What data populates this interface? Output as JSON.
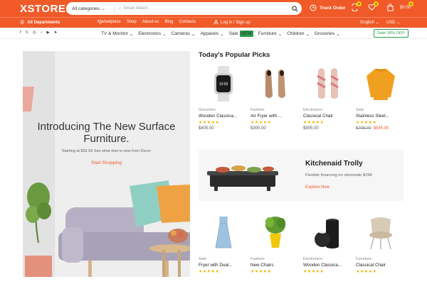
{
  "header": {
    "logo": "XSTORE.",
    "search": {
      "category": "All categories",
      "placeholder": "Smart Watch"
    },
    "track_order": "Track Order",
    "wishlist_count": "0",
    "compare_count": "0",
    "cart_count": "0",
    "cart_total": "$0.00"
  },
  "nav": {
    "all_departments": "All Departments",
    "links": [
      "Marketplace",
      "Shop",
      "About us",
      "Blog",
      "Contacts"
    ],
    "login": "Log in / Sign up",
    "language": "English",
    "currency": "USD"
  },
  "categories": {
    "items": [
      "TV & Monitor",
      "Electronics",
      "Cameras",
      "Apparels",
      "Sale",
      "Furniture",
      "Children",
      "Groceries"
    ],
    "new_tag": "NEW",
    "sale_button": "Sale! 30% OFF!"
  },
  "hero": {
    "title": "Introducing The New Surface Furniture.",
    "subtitle": "Starting at $59.99 See what else is new from Decor",
    "cta": "Start Shopping"
  },
  "popular": {
    "title": "Today's Popular Picks",
    "row1": [
      {
        "category": "Groceries",
        "name": "Wooden Classica...",
        "stars": "★★★★★",
        "price": "$405.00",
        "icon": "smartwatch-icon"
      },
      {
        "category": "Fashion",
        "name": "Air Fryer with ...",
        "stars": "★★★★★",
        "price": "$300.00",
        "icon": "shoes-icon"
      },
      {
        "category": "Electronics",
        "name": "Classical Chair",
        "stars": "★★★★★",
        "price": "$905.00",
        "icon": "sandals-icon"
      },
      {
        "category": "Sale",
        "name": "Stainless Steel...",
        "stars": "★★★★★",
        "old_price": "$705.00",
        "new_price": "$545.00",
        "icon": "sweater-icon"
      }
    ],
    "row2": [
      {
        "category": "Sale",
        "name": "Fryer with Dual...",
        "stars": "★★★★★",
        "icon": "dress-icon"
      },
      {
        "category": "Fashion",
        "name": "New Chairs",
        "stars": "★★★★★",
        "icon": "plant-icon"
      },
      {
        "category": "Electronics",
        "name": "Wooden Classica...",
        "stars": "★★★★★",
        "icon": "vase-icon"
      },
      {
        "category": "Furniture",
        "name": "Classical Chair",
        "stars": "★★★★★",
        "icon": "armchair-icon"
      }
    ]
  },
  "promo": {
    "title": "Kitchenaid Trolly",
    "subtitle": "Flexible financing on storewide $299",
    "cta": "Explore Now"
  },
  "colors": {
    "accent": "#f05a28",
    "star": "#f0b400",
    "sale_green": "#2b9c4a"
  }
}
